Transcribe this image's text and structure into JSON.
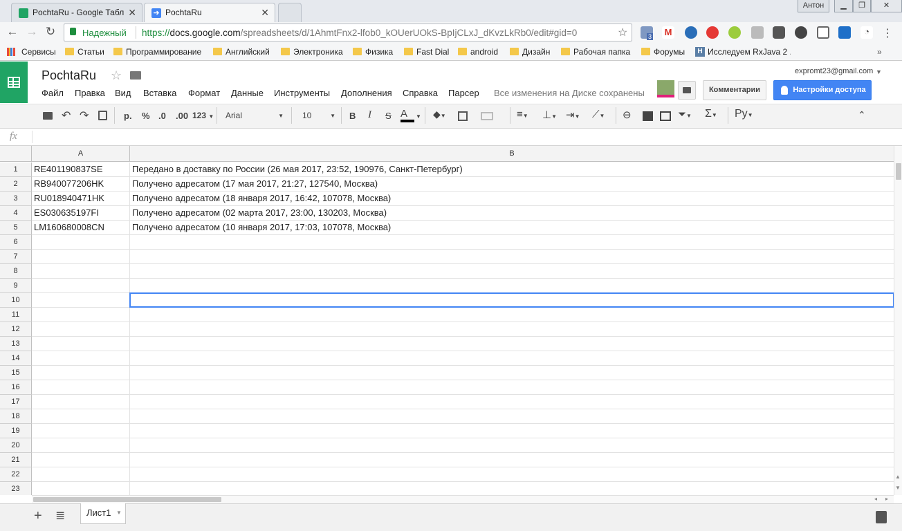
{
  "browser": {
    "tabs": [
      {
        "title": "PochtaRu - Google Табл",
        "active": false
      },
      {
        "title": "PochtaRu",
        "active": true
      }
    ],
    "user_badge": "Антон",
    "url": {
      "secure_label": "Надежный",
      "prefix": "https://",
      "host": "docs.google.com",
      "path": "/spreadsheets/d/1AhmtFnx2-lfob0_kOUerUOkS-BpIjCLxJ_dKvzLkRb0/edit#gid=0"
    },
    "bookmarks": [
      "Сервисы",
      "Статьи",
      "Программирование",
      "Английский",
      "Электроника",
      "Физика",
      "Fast Dial",
      "android",
      "Дизайн",
      "Рабочая папка",
      "Форумы",
      "Исследуем RxJava 2 ..."
    ],
    "mail_badge": "3"
  },
  "doc": {
    "title": "PochtaRu",
    "menu": [
      "Файл",
      "Правка",
      "Вид",
      "Вставка",
      "Формат",
      "Данные",
      "Инструменты",
      "Дополнения",
      "Справка",
      "Парсер"
    ],
    "save_status": "Все изменения на Диске сохранены",
    "account_email": "expromt23@gmail.com",
    "comments_label": "Комментарии",
    "share_label": "Настройки доступа"
  },
  "toolbar": {
    "currency": "р.",
    "percent": "%",
    "dec_less": ".0",
    "dec_more": ".00",
    "format_more": "123",
    "font": "Arial",
    "font_size": "10",
    "bold": "B",
    "italic": "I",
    "strike": "S",
    "text_color": "A",
    "input_tools": "Ру"
  },
  "formula": {
    "fx": "fx",
    "value": ""
  },
  "sheet": {
    "columns": [
      "A",
      "B"
    ],
    "rows": [
      {
        "n": "1",
        "a": "RE401190837SE",
        "b": "Передано в доставку по России (26 мая 2017, 23:52, 190976, Санкт-Петербург)"
      },
      {
        "n": "2",
        "a": "RB940077206HK",
        "b": "Получено адресатом (17 мая 2017, 21:27, 127540, Москва)"
      },
      {
        "n": "3",
        "a": "RU018940471HK",
        "b": "Получено адресатом (18 января 2017, 16:42, 107078, Москва)"
      },
      {
        "n": "4",
        "a": "ES030635197FI",
        "b": "Получено адресатом (02 марта 2017, 23:00, 130203, Москва)"
      },
      {
        "n": "5",
        "a": "LM160680008CN",
        "b": "Получено адресатом (10 января 2017, 17:03, 107078, Москва)"
      },
      {
        "n": "6",
        "a": "",
        "b": ""
      },
      {
        "n": "7",
        "a": "",
        "b": ""
      },
      {
        "n": "8",
        "a": "",
        "b": ""
      },
      {
        "n": "9",
        "a": "",
        "b": ""
      },
      {
        "n": "10",
        "a": "",
        "b": ""
      },
      {
        "n": "11",
        "a": "",
        "b": ""
      },
      {
        "n": "12",
        "a": "",
        "b": ""
      },
      {
        "n": "13",
        "a": "",
        "b": ""
      },
      {
        "n": "14",
        "a": "",
        "b": ""
      },
      {
        "n": "15",
        "a": "",
        "b": ""
      },
      {
        "n": "16",
        "a": "",
        "b": ""
      },
      {
        "n": "17",
        "a": "",
        "b": ""
      },
      {
        "n": "18",
        "a": "",
        "b": ""
      },
      {
        "n": "19",
        "a": "",
        "b": ""
      },
      {
        "n": "20",
        "a": "",
        "b": ""
      },
      {
        "n": "21",
        "a": "",
        "b": ""
      },
      {
        "n": "22",
        "a": "",
        "b": ""
      },
      {
        "n": "23",
        "a": "",
        "b": ""
      }
    ],
    "selected_cell": "B10",
    "sheet_tab": "Лист1"
  },
  "colors": {
    "sheets_green": "#20a464",
    "share_blue": "#4285f4",
    "selection_blue": "#4285f4"
  }
}
